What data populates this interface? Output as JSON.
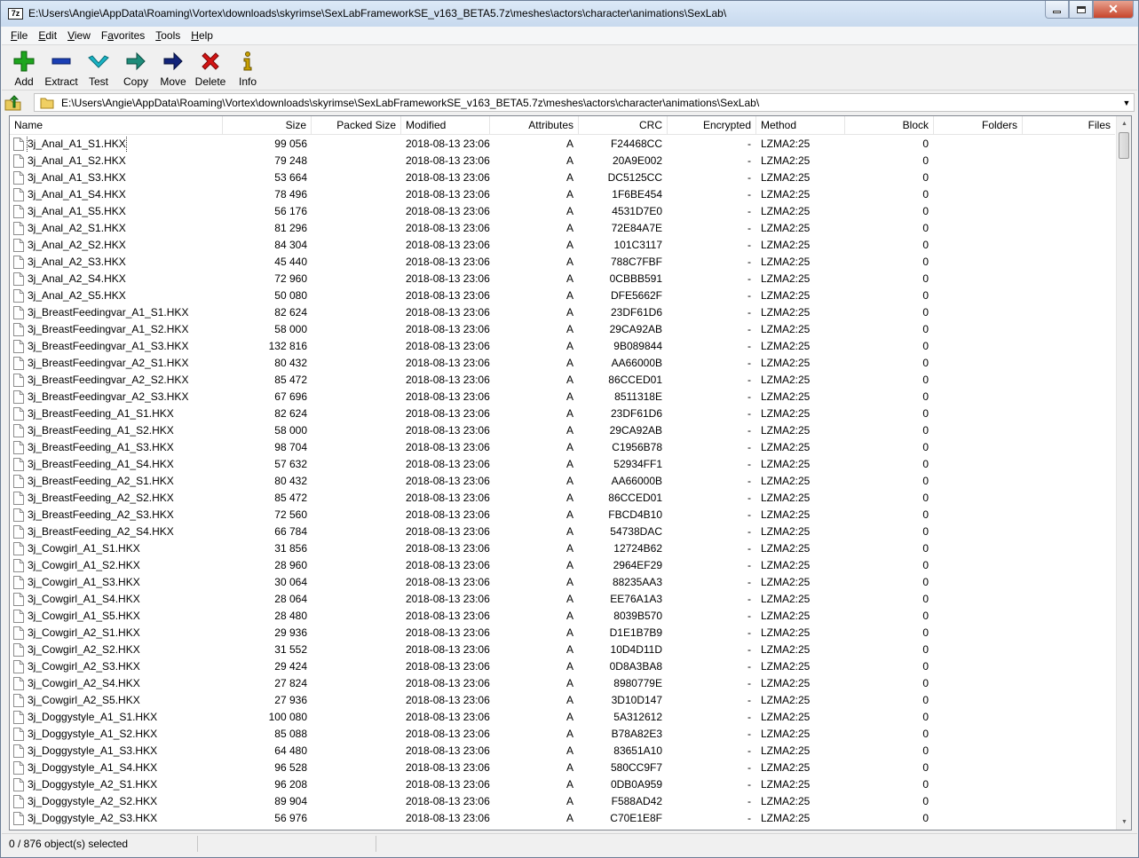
{
  "window": {
    "title": "E:\\Users\\Angie\\AppData\\Roaming\\Vortex\\downloads\\skyrimse\\SexLabFrameworkSE_v163_BETA5.7z\\meshes\\actors\\character\\animations\\SexLab\\",
    "app_icon_text": "7z"
  },
  "menu": [
    {
      "u": "F",
      "rest": "ile"
    },
    {
      "u": "E",
      "rest": "dit"
    },
    {
      "u": "V",
      "rest": "iew"
    },
    {
      "u": "F",
      "rest": "avorites",
      "pre": ""
    },
    {
      "u": "T",
      "rest": "ools"
    },
    {
      "u": "H",
      "rest": "elp"
    }
  ],
  "toolbar": {
    "add": "Add",
    "extract": "Extract",
    "test": "Test",
    "copy": "Copy",
    "move": "Move",
    "delete": "Delete",
    "info": "Info",
    "colors": {
      "add": "#1ea51e",
      "extract": "#1a3fb5",
      "test": "#19b3c4",
      "copy": "#1e8c7a",
      "move": "#12247a",
      "delete": "#d41414",
      "info": "#c8a000"
    }
  },
  "address": {
    "path": "E:\\Users\\Angie\\AppData\\Roaming\\Vortex\\downloads\\skyrimse\\SexLabFrameworkSE_v163_BETA5.7z\\meshes\\actors\\character\\animations\\SexLab\\"
  },
  "columns": {
    "name": "Name",
    "size": "Size",
    "packed": "Packed Size",
    "modified": "Modified",
    "attributes": "Attributes",
    "crc": "CRC",
    "encrypted": "Encrypted",
    "method": "Method",
    "block": "Block",
    "folders": "Folders",
    "files": "Files"
  },
  "files": [
    [
      "3j_Anal_A1_S1.HKX",
      "99 056",
      "F24468CC"
    ],
    [
      "3j_Anal_A1_S2.HKX",
      "79 248",
      "20A9E002"
    ],
    [
      "3j_Anal_A1_S3.HKX",
      "53 664",
      "DC5125CC"
    ],
    [
      "3j_Anal_A1_S4.HKX",
      "78 496",
      "1F6BE454"
    ],
    [
      "3j_Anal_A1_S5.HKX",
      "56 176",
      "4531D7E0"
    ],
    [
      "3j_Anal_A2_S1.HKX",
      "81 296",
      "72E84A7E"
    ],
    [
      "3j_Anal_A2_S2.HKX",
      "84 304",
      "101C3117"
    ],
    [
      "3j_Anal_A2_S3.HKX",
      "45 440",
      "788C7FBF"
    ],
    [
      "3j_Anal_A2_S4.HKX",
      "72 960",
      "0CBBB591"
    ],
    [
      "3j_Anal_A2_S5.HKX",
      "50 080",
      "DFE5662F"
    ],
    [
      "3j_BreastFeedingvar_A1_S1.HKX",
      "82 624",
      "23DF61D6"
    ],
    [
      "3j_BreastFeedingvar_A1_S2.HKX",
      "58 000",
      "29CA92AB"
    ],
    [
      "3j_BreastFeedingvar_A1_S3.HKX",
      "132 816",
      "9B089844"
    ],
    [
      "3j_BreastFeedingvar_A2_S1.HKX",
      "80 432",
      "AA66000B"
    ],
    [
      "3j_BreastFeedingvar_A2_S2.HKX",
      "85 472",
      "86CCED01"
    ],
    [
      "3j_BreastFeedingvar_A2_S3.HKX",
      "67 696",
      "8511318E"
    ],
    [
      "3j_BreastFeeding_A1_S1.HKX",
      "82 624",
      "23DF61D6"
    ],
    [
      "3j_BreastFeeding_A1_S2.HKX",
      "58 000",
      "29CA92AB"
    ],
    [
      "3j_BreastFeeding_A1_S3.HKX",
      "98 704",
      "C1956B78"
    ],
    [
      "3j_BreastFeeding_A1_S4.HKX",
      "57 632",
      "52934FF1"
    ],
    [
      "3j_BreastFeeding_A2_S1.HKX",
      "80 432",
      "AA66000B"
    ],
    [
      "3j_BreastFeeding_A2_S2.HKX",
      "85 472",
      "86CCED01"
    ],
    [
      "3j_BreastFeeding_A2_S3.HKX",
      "72 560",
      "FBCD4B10"
    ],
    [
      "3j_BreastFeeding_A2_S4.HKX",
      "66 784",
      "54738DAC"
    ],
    [
      "3j_Cowgirl_A1_S1.HKX",
      "31 856",
      "12724B62"
    ],
    [
      "3j_Cowgirl_A1_S2.HKX",
      "28 960",
      "2964EF29"
    ],
    [
      "3j_Cowgirl_A1_S3.HKX",
      "30 064",
      "88235AA3"
    ],
    [
      "3j_Cowgirl_A1_S4.HKX",
      "28 064",
      "EE76A1A3"
    ],
    [
      "3j_Cowgirl_A1_S5.HKX",
      "28 480",
      "8039B570"
    ],
    [
      "3j_Cowgirl_A2_S1.HKX",
      "29 936",
      "D1E1B7B9"
    ],
    [
      "3j_Cowgirl_A2_S2.HKX",
      "31 552",
      "10D4D11D"
    ],
    [
      "3j_Cowgirl_A2_S3.HKX",
      "29 424",
      "0D8A3BA8"
    ],
    [
      "3j_Cowgirl_A2_S4.HKX",
      "27 824",
      "8980779E"
    ],
    [
      "3j_Cowgirl_A2_S5.HKX",
      "27 936",
      "3D10D147"
    ],
    [
      "3j_Doggystyle_A1_S1.HKX",
      "100 080",
      "5A312612"
    ],
    [
      "3j_Doggystyle_A1_S2.HKX",
      "85 088",
      "B78A82E3"
    ],
    [
      "3j_Doggystyle_A1_S3.HKX",
      "64 480",
      "83651A10"
    ],
    [
      "3j_Doggystyle_A1_S4.HKX",
      "96 528",
      "580CC9F7"
    ],
    [
      "3j_Doggystyle_A2_S1.HKX",
      "96 208",
      "0DB0A959"
    ],
    [
      "3j_Doggystyle_A2_S2.HKX",
      "89 904",
      "F588AD42"
    ],
    [
      "3j_Doggystyle_A2_S3.HKX",
      "56 976",
      "C70E1E8F"
    ]
  ],
  "common": {
    "modified": "2018-08-13 23:06",
    "attributes": "A",
    "encrypted": "-",
    "method": "LZMA2:25",
    "block": "0"
  },
  "status": {
    "text": "0 / 876 object(s) selected"
  }
}
